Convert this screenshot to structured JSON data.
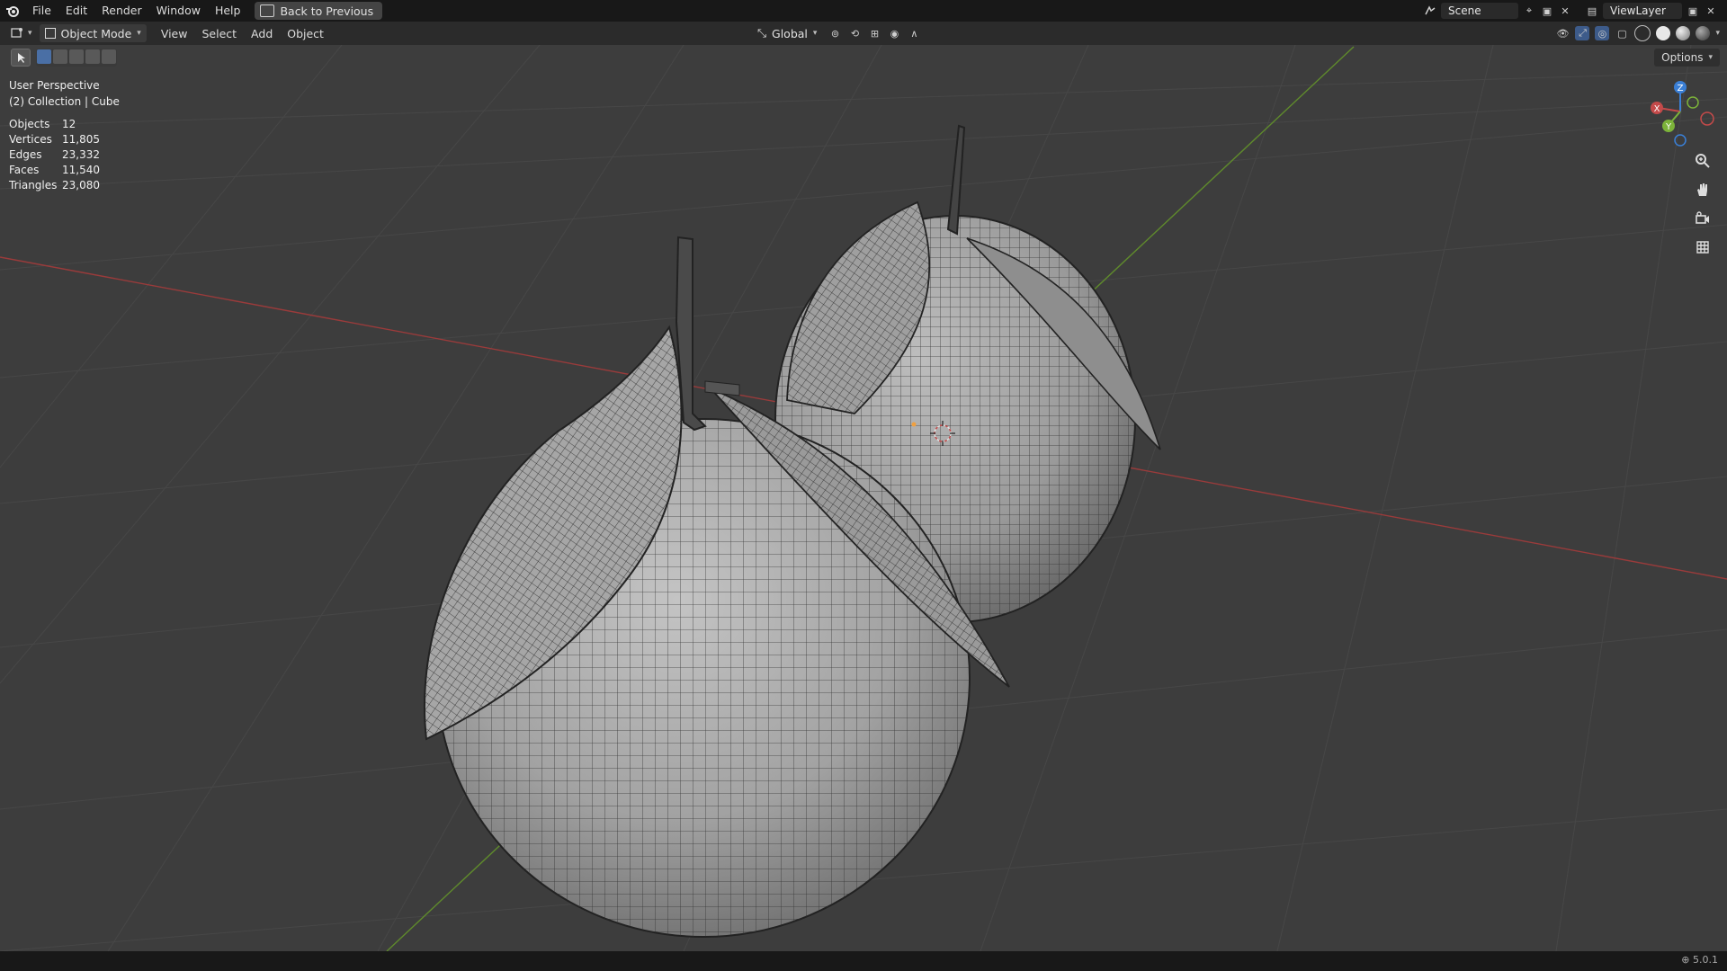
{
  "menu": {
    "items": [
      "File",
      "Edit",
      "Render",
      "Window",
      "Help"
    ],
    "back_to_previous": "Back to Previous"
  },
  "scene": {
    "name": "Scene",
    "view_layer": "ViewLayer"
  },
  "header": {
    "mode": "Object Mode",
    "menus": [
      "View",
      "Select",
      "Add",
      "Object"
    ],
    "transform_orientation": "Global",
    "options": "Options"
  },
  "viewport": {
    "perspective": "User Perspective",
    "collection": "(2) Collection | Cube"
  },
  "stats": [
    {
      "label": "Objects",
      "value": "12"
    },
    {
      "label": "Vertices",
      "value": "11,805"
    },
    {
      "label": "Edges",
      "value": "23,332"
    },
    {
      "label": "Faces",
      "value": "11,540"
    },
    {
      "label": "Triangles",
      "value": "23,080"
    }
  ],
  "gizmo": {
    "x": "X",
    "y": "Y",
    "z": "Z"
  },
  "status": {
    "version": "5.0.1"
  },
  "colors": {
    "accent": "#4a6fa5",
    "x_axis": "#c44a4a",
    "y_axis": "#7cb33a",
    "z_axis": "#3a7fd6",
    "viewport_bg": "#3d3d3d"
  },
  "icons": [
    "blender-logo-icon",
    "back-icon",
    "scene-icon",
    "pin-icon",
    "view-layer-icon",
    "zoom-icon",
    "hand-icon",
    "camera-icon",
    "grid-icon"
  ]
}
